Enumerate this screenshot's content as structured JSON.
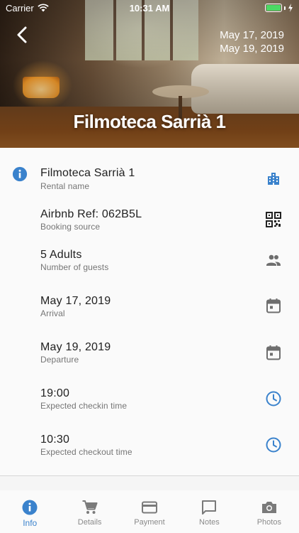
{
  "status_bar": {
    "carrier": "Carrier",
    "time": "10:31 AM"
  },
  "header": {
    "title": "Filmoteca Sarrià 1",
    "date_from": "May 17, 2019",
    "date_to": "May 19, 2019"
  },
  "details": [
    {
      "value": "Filmoteca Sarrià 1",
      "label": "Rental name",
      "icon": "building-icon"
    },
    {
      "value": "Airbnb Ref: 062B5L",
      "label": "Booking source",
      "icon": "qr-code-icon"
    },
    {
      "value": "5 Adults",
      "label": "Number of guests",
      "icon": "people-icon"
    },
    {
      "value": "May 17, 2019",
      "label": "Arrival",
      "icon": "calendar-icon"
    },
    {
      "value": "May 19, 2019",
      "label": "Departure",
      "icon": "calendar-icon"
    },
    {
      "value": "19:00",
      "label": "Expected checkin time",
      "icon": "clock-icon"
    },
    {
      "value": "10:30",
      "label": "Expected checkout time",
      "icon": "clock-icon"
    }
  ],
  "tabs": [
    {
      "label": "Info",
      "icon": "info-icon",
      "active": true
    },
    {
      "label": "Details",
      "icon": "cart-icon",
      "active": false
    },
    {
      "label": "Payment",
      "icon": "credit-card-icon",
      "active": false
    },
    {
      "label": "Notes",
      "icon": "chat-bubble-icon",
      "active": false
    },
    {
      "label": "Photos",
      "icon": "camera-icon",
      "active": false
    }
  ],
  "colors": {
    "accent": "#3a82cc",
    "icon_grey": "#6e6e6e",
    "battery": "#4cd964"
  }
}
